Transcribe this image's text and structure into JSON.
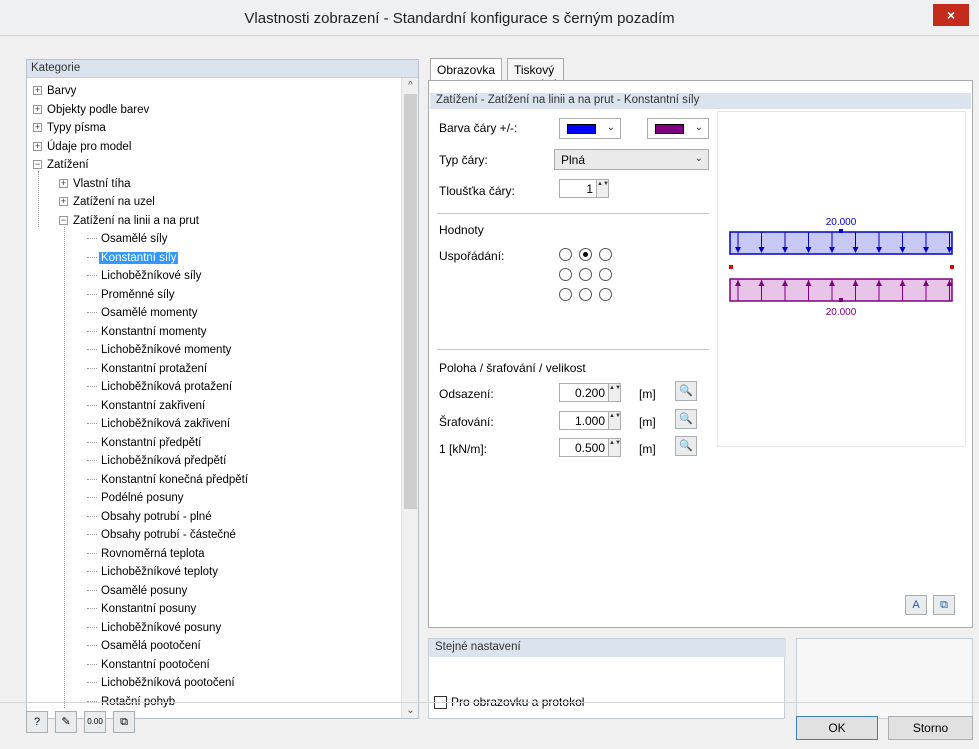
{
  "window": {
    "title": "Vlastnosti zobrazení - Standardní konfigurace s černým pozadím",
    "close_glyph": "×"
  },
  "left_panel": {
    "header": "Kategorie",
    "items": [
      {
        "label": "Barvy",
        "expander": "+"
      },
      {
        "label": "Objekty podle barev",
        "expander": "+"
      },
      {
        "label": "Typy písma",
        "expander": "+"
      },
      {
        "label": "Údaje pro model",
        "expander": "+"
      },
      {
        "label": "Zatížení",
        "expander": "−"
      },
      {
        "label": "Vlastní tíha",
        "expander": "+"
      },
      {
        "label": "Zatížení na uzel",
        "expander": "+"
      },
      {
        "label": "Zatížení na linii a na prut",
        "expander": "−"
      },
      {
        "label": "Osamělé síly"
      },
      {
        "label": "Konstantní síly"
      },
      {
        "label": "Lichoběžníkové síly"
      },
      {
        "label": "Proměnné síly"
      },
      {
        "label": "Osamělé momenty"
      },
      {
        "label": "Konstantní momenty"
      },
      {
        "label": "Lichoběžníkové momenty"
      },
      {
        "label": "Konstantní protažení"
      },
      {
        "label": "Lichoběžníková protažení"
      },
      {
        "label": "Konstantní zakřivení"
      },
      {
        "label": "Lichoběžníková zakřivení"
      },
      {
        "label": "Konstantní předpětí"
      },
      {
        "label": "Lichoběžníková předpětí"
      },
      {
        "label": "Konstantní konečná předpětí"
      },
      {
        "label": "Podélné posuny"
      },
      {
        "label": "Obsahy potrubí - plné"
      },
      {
        "label": "Obsahy potrubí - částečné"
      },
      {
        "label": "Rovnoměrná teplota"
      },
      {
        "label": "Lichoběžníkové teploty"
      },
      {
        "label": "Osamělé posuny"
      },
      {
        "label": "Konstantní posuny"
      },
      {
        "label": "Lichoběžníkové posuny"
      },
      {
        "label": "Osamělá pootočení"
      },
      {
        "label": "Konstantní pootočení"
      },
      {
        "label": "Lichoběžníková pootočení"
      },
      {
        "label": "Rotační pohyb"
      }
    ],
    "selected_index": 9,
    "scroll": {
      "up": "^",
      "down": "⌄"
    }
  },
  "tabs": [
    {
      "label": "Obrazovka"
    },
    {
      "label": "Tiskový protokol"
    }
  ],
  "section_title": "Zatížení - Zatížení na linii a na prut - Konstantní síly",
  "line_color": {
    "label": "Barva čáry +/-:",
    "positive": "#0000ff",
    "negative": "#800080"
  },
  "line_type": {
    "label": "Typ čáry:",
    "value": "Plná"
  },
  "line_width": {
    "label": "Tloušťka čáry:",
    "value": "1"
  },
  "values": {
    "header": "Hodnoty",
    "arrangement_label": "Uspořádání:",
    "selected_radio": 1
  },
  "position": {
    "header": "Poloha / šrafování / velikost",
    "rows": [
      {
        "label": "Odsazení:",
        "value": "0.200",
        "unit": "[m]"
      },
      {
        "label": "Šrafování:",
        "value": "1.000",
        "unit": "[m]"
      },
      {
        "label": "1  [kN/m]:",
        "value": "0.500",
        "unit": "[m]"
      }
    ]
  },
  "preview": {
    "top_value": "20.000",
    "bottom_value": "20.000",
    "positive_color": "#0000cc",
    "negative_color": "#800080",
    "positive_fill": "#c8c8f4",
    "negative_fill": "#e8c4e8"
  },
  "same_settings": {
    "header": "Stejné nastavení",
    "checkbox_label": "Pro obrazovku a protokol"
  },
  "buttons": {
    "ok": "OK",
    "cancel": "Storno"
  },
  "toolbar_icons": [
    "help-icon",
    "edit-icon",
    "decimal-places-icon",
    "copy-settings-icon"
  ],
  "toolbar_glyphs": {
    "help": "?",
    "edit": "✎",
    "decimal": "0.00",
    "copy": "⧉",
    "font": "A",
    "reset": "⧉",
    "search": "🔍",
    "arrow": "⌄",
    "spin": "▲▼"
  }
}
